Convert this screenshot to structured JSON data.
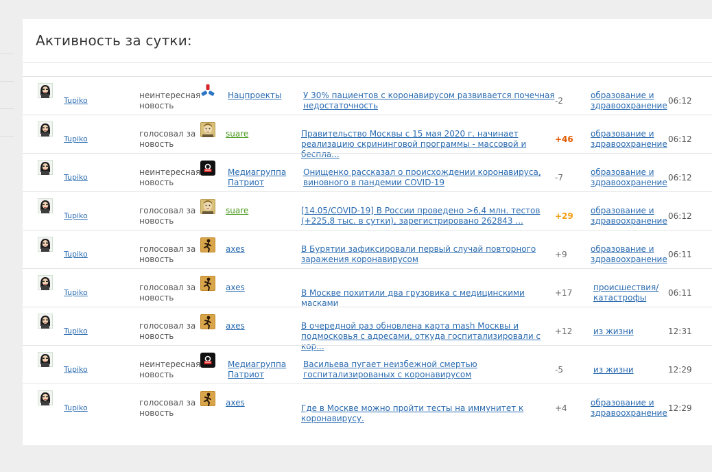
{
  "page": {
    "title": "Активность за сутки:"
  },
  "rows": [
    {
      "user": "Tupiko",
      "action": "неинтересная новость",
      "source": "Нацпроекты",
      "source_icon": "star-burst-icon",
      "news": "У 30% пациентов с коронавирусом развивается почечная недостаточность",
      "score": "-2",
      "score_style": "neutral",
      "category": "образование и здравоохранение",
      "time": "06:12"
    },
    {
      "user": "Tupiko",
      "action": "голосовал за новость",
      "source": "suare",
      "source_icon": "face-avatar-icon",
      "news": "Правительство Москвы с 15 мая 2020 г. начинает реализацию скрининговой программы - массовой и бесплa...",
      "score": "+46",
      "score_style": "hot",
      "category": "образование и здравоохранение",
      "time": "06:12"
    },
    {
      "user": "Tupiko",
      "action": "неинтересная новость",
      "source": "Медиагруппа Патриот",
      "source_icon": "patriot-logo-icon",
      "news": "Онищенко рассказал о происхождении коронавируса, виновного в пандемии COVID-19",
      "score": "-7",
      "score_style": "neutral",
      "category": "образование и здравоохранение",
      "time": "06:12"
    },
    {
      "user": "Tupiko",
      "action": "голосовал за новость",
      "source": "suare",
      "source_icon": "face-avatar-icon",
      "news": "[14.05/COVID-19] В России проведено >6,4 млн. тестов (+225,8 тыс. в сутки), зарегистрировано 262843 ...",
      "score": "+29",
      "score_style": "warm",
      "category": "образование и здравоохранение",
      "time": "06:12"
    },
    {
      "user": "Tupiko",
      "action": "голосовал за новость",
      "source": "axes",
      "source_icon": "runner-icon",
      "news": "В Бурятии зафиксировали первый случай повторного заражения коронавирусом",
      "score": "+9",
      "score_style": "neutral",
      "category": "образование и здравоохранение",
      "time": "06:11"
    },
    {
      "user": "Tupiko",
      "action": "голосовал за новость",
      "source": "axes",
      "source_icon": "runner-icon",
      "news": "В Москве похитили два грузовика с медицинскими масками",
      "score": "+17",
      "score_style": "neutral",
      "category": "происшествия/ катастрофы",
      "time": "06:11"
    },
    {
      "user": "Tupiko",
      "action": "голосовал за новость",
      "source": "axes",
      "source_icon": "runner-icon",
      "news": "В очередной раз обновлена карта mash Москвы и подмосковья с адресами, откуда госпитализировали с кор...",
      "score": "+12",
      "score_style": "neutral",
      "category": "из жизни",
      "time": "12:31"
    },
    {
      "user": "Tupiko",
      "action": "неинтересная новость",
      "source": "Медиагруппа Патриот",
      "source_icon": "patriot-logo-icon",
      "news": "Васильева пугает неизбежной смертью госпитализированых с коронавирусом",
      "score": "-5",
      "score_style": "neutral",
      "category": "из жизни",
      "time": "12:29"
    },
    {
      "user": "Tupiko",
      "action": "голосовал за новость",
      "source": "axes",
      "source_icon": "runner-icon",
      "news": "Где в Москве можно пройти тесты на иммунитет к коронавирусу.",
      "score": "+4",
      "score_style": "neutral",
      "category": "образование и здравоохранение",
      "time": "12:29"
    }
  ]
}
